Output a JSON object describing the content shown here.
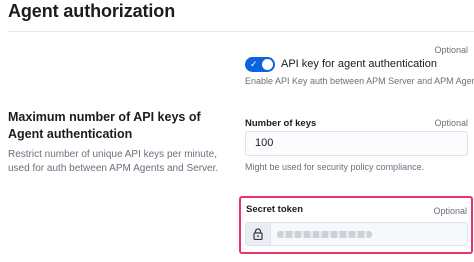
{
  "page": {
    "title": "Agent authorization"
  },
  "api_key_auth": {
    "optional_label": "Optional",
    "toggle_label": "API key for agent authentication",
    "toggle_state": "on",
    "help_text": "Enable API Key auth between APM Server and APM Agents."
  },
  "max_keys_section": {
    "title": "Maximum number of API keys of Agent authentication",
    "description": "Restrict number of unique API keys per minute, used for auth between APM Agents and Server.",
    "field_label": "Number of keys",
    "optional_label": "Optional",
    "value": "100",
    "help_text": "Might be used for security policy compliance."
  },
  "secret_token": {
    "field_label": "Secret token",
    "optional_label": "Optional",
    "icon": "lock-icon",
    "value_masked": true
  },
  "colors": {
    "accent": "#0b64dd",
    "highlight": "#e8336d"
  }
}
